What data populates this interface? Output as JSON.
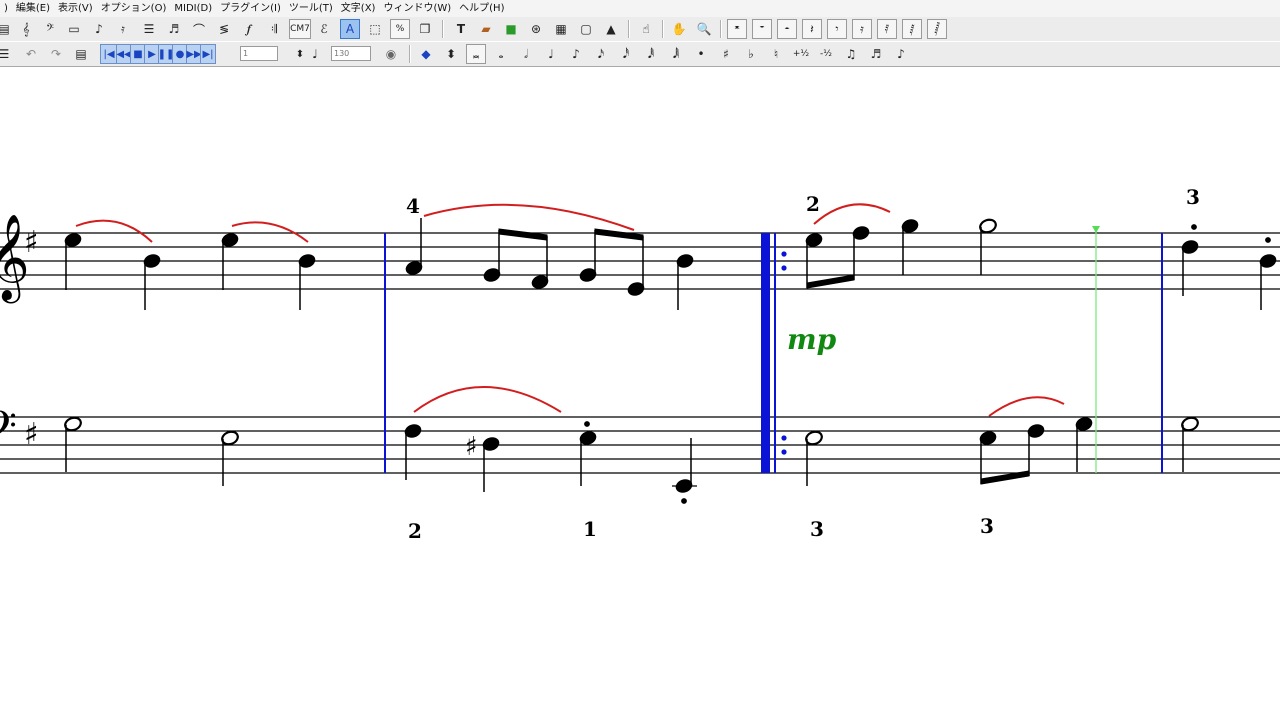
{
  "menu": {
    "items": [
      ")",
      "編集(E)",
      "表示(V)",
      "オプション(O)",
      "MIDI(D)",
      "プラグイン(I)",
      "ツール(T)",
      "文字(X)",
      "ウィンドウ(W)",
      "ヘルプ(H)"
    ]
  },
  "toolbar": {
    "chord_label": "CM7",
    "text_tool_label": "A",
    "percent_label": "%",
    "tempo_value": "130",
    "measure_field": "1",
    "half_plus_label": "+½",
    "half_minus_label": "-½"
  },
  "score": {
    "key_signature": "G major (1 sharp)",
    "dynamic": "mp",
    "fingerings": {
      "treble_m2": "4",
      "treble_m3": "2",
      "treble_m4": "3",
      "bass_m2_a": "2",
      "bass_m2_b": "1",
      "bass_m3_a": "3",
      "bass_m3_b": "3"
    },
    "colors": {
      "barline": "#0b14d6",
      "slur": "#d21e1e",
      "dynamic": "#118811",
      "cursor": "#7ee87e",
      "notes": "#000000"
    }
  }
}
